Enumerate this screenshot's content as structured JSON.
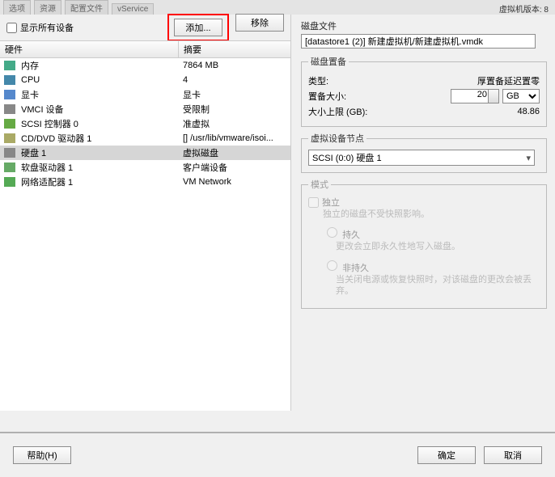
{
  "version_text": "虚拟机版本: 8",
  "show_all_label": "显示所有设备",
  "buttons": {
    "add": "添加...",
    "remove": "移除",
    "help": "帮助(H)",
    "ok": "确定",
    "cancel": "取消"
  },
  "headers": {
    "hw": "硬件",
    "summary": "摘要"
  },
  "devices": [
    {
      "icon": "mem",
      "name": "内存",
      "summary": "7864 MB",
      "sel": false
    },
    {
      "icon": "cpu",
      "name": "CPU",
      "summary": "4",
      "sel": false
    },
    {
      "icon": "vid",
      "name": "显卡",
      "summary": "显卡",
      "sel": false
    },
    {
      "icon": "vmci",
      "name": "VMCI 设备",
      "summary": "受限制",
      "sel": false
    },
    {
      "icon": "scsi",
      "name": "SCSI 控制器 0",
      "summary": "准虚拟",
      "sel": false
    },
    {
      "icon": "cd",
      "name": "CD/DVD 驱动器 1",
      "summary": "[] /usr/lib/vmware/isoi...",
      "sel": false
    },
    {
      "icon": "hdd",
      "name": "硬盘 1",
      "summary": "虚拟磁盘",
      "sel": true
    },
    {
      "icon": "fdd",
      "name": "软盘驱动器 1",
      "summary": "客户端设备",
      "sel": false
    },
    {
      "icon": "net",
      "name": "网络适配器 1",
      "summary": "VM Network",
      "sel": false
    }
  ],
  "disk_file": {
    "label": "磁盘文件",
    "value": "[datastore1 (2)] 新建虚拟机/新建虚拟机.vmdk"
  },
  "provision": {
    "legend": "磁盘置备",
    "type_label": "类型:",
    "type_value": "厚置备延迟置零",
    "size_label": "置备大小:",
    "size_value": "20",
    "size_unit": "GB",
    "max_label": "大小上限 (GB):",
    "max_value": "48.86"
  },
  "node": {
    "legend": "虚拟设备节点",
    "value": "SCSI (0:0) 硬盘 1"
  },
  "mode": {
    "legend": "模式",
    "indep_label": "独立",
    "indep_desc": "独立的磁盘不受快照影响。",
    "persist_label": "持久",
    "persist_desc": "更改会立即永久性地写入磁盘。",
    "nonpersist_label": "非持久",
    "nonpersist_desc": "当关闭电源或恢复快照时，对该磁盘的更改会被丢弃。"
  }
}
